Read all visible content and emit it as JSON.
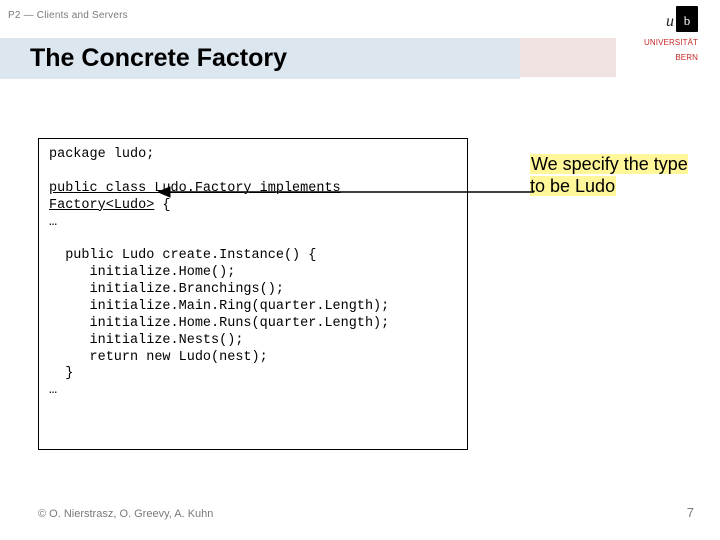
{
  "breadcrumb": "P2 — Clients and Servers",
  "title": "The Concrete Factory",
  "logo": {
    "u": "u",
    "b": "b",
    "line1": "UNIVERSITÄT",
    "line2": "BERN"
  },
  "code": {
    "l1": "package ludo;",
    "l2": "",
    "l3a": "public class Ludo.Factory implements",
    "l3b": "Factory",
    "l3c": "<Ludo>",
    "l3d": " {",
    "l4": "…",
    "l5": "",
    "l6": "  public Ludo create.Instance() {",
    "l7": "     initialize.Home();",
    "l8": "     initialize.Branchings();",
    "l9": "     initialize.Main.Ring(quarter.Length);",
    "l10": "     initialize.Home.Runs(quarter.Length);",
    "l11": "     initialize.Nests();",
    "l12": "     return new Ludo(nest);",
    "l13": "  }",
    "l14": "…"
  },
  "annotation": "We specify the type to be Ludo",
  "footer_left": "© O. Nierstrasz, O. Greevy, A. Kuhn",
  "page_number": "7"
}
